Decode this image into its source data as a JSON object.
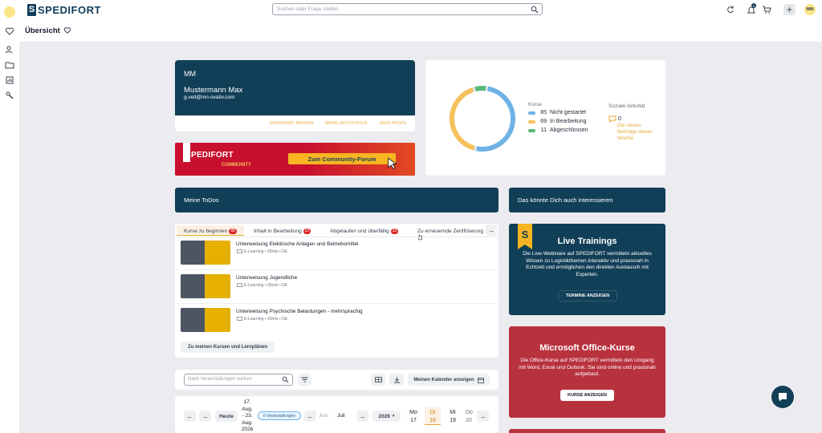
{
  "header": {
    "logo_text": "SPEDIFORT",
    "search_placeholder": "Suchen oder Frage stellen",
    "notification_count": "0",
    "avatar_initials": "MM"
  },
  "page": {
    "title": "Übersicht"
  },
  "profile": {
    "initials": "MM",
    "name": "Mustermann Max",
    "email": "g.veit@inn-ovativ.com",
    "links": [
      "KENNWORT ÄNDERN",
      "MEINE AKTIVITÄTEN",
      "MEIN PROFIL"
    ]
  },
  "community_banner": {
    "brand": "SPEDIFORT",
    "community": "COMMUNITY",
    "button": "Zum Community-Forum"
  },
  "stats": {
    "courses_label": "Kurse",
    "items": [
      {
        "value": "85",
        "label": "Nicht gestartet",
        "color": "#6fb3e6"
      },
      {
        "value": "69",
        "label": "In Bearbeitung",
        "color": "#f6c15b"
      },
      {
        "value": "11",
        "label": "Abgeschlossen",
        "color": "#59b87a"
      }
    ],
    "social_label": "Soziale Aktivität",
    "social_count": "0",
    "social_text": "Die neuen Beiträge dieser Woche"
  },
  "todos": {
    "title": "Meine ToDos",
    "tabs": [
      {
        "label": "Kurse zu beginnen",
        "count": "88"
      },
      {
        "label": "Inhalt in Bearbeitung",
        "count": "22"
      },
      {
        "label": "Abgelaufen und überfällig",
        "count": "33"
      },
      {
        "label": "Zu erneuernde Zertifizierung",
        "count": ""
      }
    ],
    "rows": [
      {
        "title": "Unterweisung Elektrische Anlagen und Betriebsmittel",
        "meta": "E-Learning • 25min • DE"
      },
      {
        "title": "Unterweisung Jugendliche",
        "meta": "E-Learning • 25min • DE"
      },
      {
        "title": "Unterweisung Psychische Belastungen - mehrsprachig",
        "meta": "E-Learning • 20min • DE"
      }
    ],
    "button": "Zu meinen Kursen und Lernplänen"
  },
  "interest": {
    "title": "Das könnte Dich auch interessieren"
  },
  "live": {
    "title": "Live Trainings",
    "text": "Die Live-Webinare auf SPEDIFORT vermitteln aktuelles Wissen zu Logistikthemen interaktiv und praxisnah in Echtzeit und ermöglichen den direkten Austausch mit Experten.",
    "button": "TERMINE ANZEIGEN"
  },
  "office": {
    "title": "Microsoft Office-Kurse",
    "text": "Die Office-Kurse auf SPEDIFORT vermitteln den Umgang mit Word, Excel und Outlook. Sie sind online und praxisnah aufgebaut.",
    "button": "KURSE ANZEIGEN"
  },
  "events": {
    "search_placeholder": "Nach Veranstaltungen suchen",
    "calendar_button": "Meinen Kalender anzeigen"
  },
  "calendar": {
    "today": "Heute",
    "range": [
      "17.",
      "Aug.",
      "- 23.",
      "Aug.",
      "2026"
    ],
    "events_badge": "0 Veranstaltungen",
    "months": [
      "Juni",
      "Juli"
    ],
    "year": "2026",
    "days": [
      {
        "dow": "Mo",
        "num": "17"
      },
      {
        "dow": "Di",
        "num": "18"
      },
      {
        "dow": "Mi",
        "num": "19"
      },
      {
        "dow": "Do",
        "num": "20"
      }
    ]
  }
}
